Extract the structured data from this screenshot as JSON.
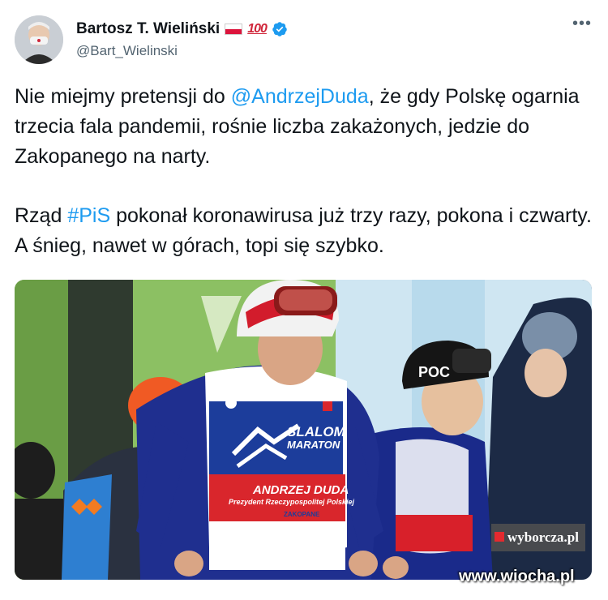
{
  "author": {
    "name": "Bartosz T. Wieliński",
    "handle": "@Bart_Wielinski",
    "badge_number": "100",
    "verified": true
  },
  "more_menu": {
    "label": "•••"
  },
  "tweet": {
    "paragraph1": {
      "before": "Nie miejmy pretensji do ",
      "mention": "@AndrzejDuda",
      "after": ", że gdy Polskę ogarnia trzecia fala pandemii, rośnie liczba zakażonych, jedzie do Zakopanego na narty."
    },
    "paragraph2": {
      "before": "Rząd ",
      "hashtag": "#PiS",
      "after": "  pokonał koronawirusa już trzy razy, pokona i czwarty. A śnieg, nawet w górach, topi się szybko."
    }
  },
  "photo": {
    "helmet_text": "POC",
    "bib": {
      "event_line1": "SLALOM",
      "event_line2": "MARATON",
      "name": "ANDRZEJ DUDA",
      "title": "Prezydent Rzeczypospolitej Polskiej",
      "town": "ZAKOPANE"
    },
    "credit": "wyborcza.pl"
  },
  "site_watermark": "www.wiocha.pl",
  "colors": {
    "link": "#1d9bf0",
    "text": "#0f1419",
    "secondary": "#536471",
    "verified": "#1d9bf0"
  }
}
